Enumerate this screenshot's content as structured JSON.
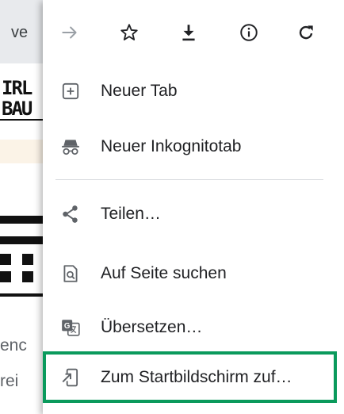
{
  "background": {
    "url_fragment": "ve",
    "logo_text": "IRL\nBAU",
    "text_line_1": "enc",
    "text_line_2": "rei"
  },
  "toolbar": {
    "buttons": [
      {
        "icon": "forward-arrow-icon",
        "enabled": false
      },
      {
        "icon": "star-icon",
        "enabled": true
      },
      {
        "icon": "download-icon",
        "enabled": true
      },
      {
        "icon": "info-icon",
        "enabled": true
      },
      {
        "icon": "reload-icon",
        "enabled": true
      }
    ]
  },
  "menu": {
    "items": [
      {
        "label": "Neuer Tab",
        "icon": "new-tab-icon"
      },
      {
        "label": "Neuer Inkognitotab",
        "icon": "incognito-icon"
      },
      {
        "label": "Teilen…",
        "icon": "share-icon"
      },
      {
        "label": "Auf Seite suchen",
        "icon": "find-in-page-icon"
      },
      {
        "label": "Übersetzen…",
        "icon": "translate-icon"
      },
      {
        "label": "Zum Startbildschirm zuf…",
        "icon": "add-to-home-screen-icon",
        "highlighted": true
      }
    ]
  },
  "colors": {
    "highlight_border": "#0a9a5c",
    "icon_gray": "#5f6368",
    "disabled_gray": "#9aa0a6"
  }
}
